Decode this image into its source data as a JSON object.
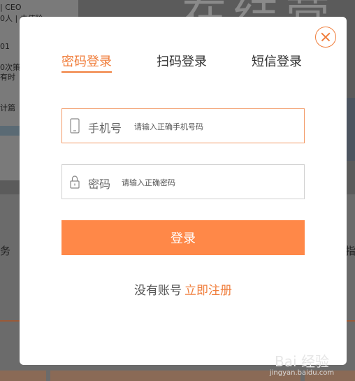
{
  "background": {
    "left_lines": [
      "| CEO",
      "0人 | 未使阶",
      "01",
      "0次策吗",
      "有时",
      "计篇"
    ],
    "big_text": "在结营",
    "edge_left": "务",
    "edge_right": "指"
  },
  "modal": {
    "tabs": [
      {
        "label": "密码登录",
        "active": true
      },
      {
        "label": "扫码登录",
        "active": false
      },
      {
        "label": "短信登录",
        "active": false
      }
    ],
    "phone_field": {
      "label": "手机号",
      "placeholder": "请输入正确手机号码",
      "value": ""
    },
    "password_field": {
      "label": "密码",
      "placeholder": "请输入正确密码",
      "value": ""
    },
    "login_button": "登录",
    "no_account_text": "没有账号",
    "register_link": "立即注册"
  },
  "watermark": {
    "text": "Bai 经验",
    "url": "jingyan.baidu.com"
  },
  "colors": {
    "accent": "#f07e3c",
    "button": "#ff8848"
  }
}
